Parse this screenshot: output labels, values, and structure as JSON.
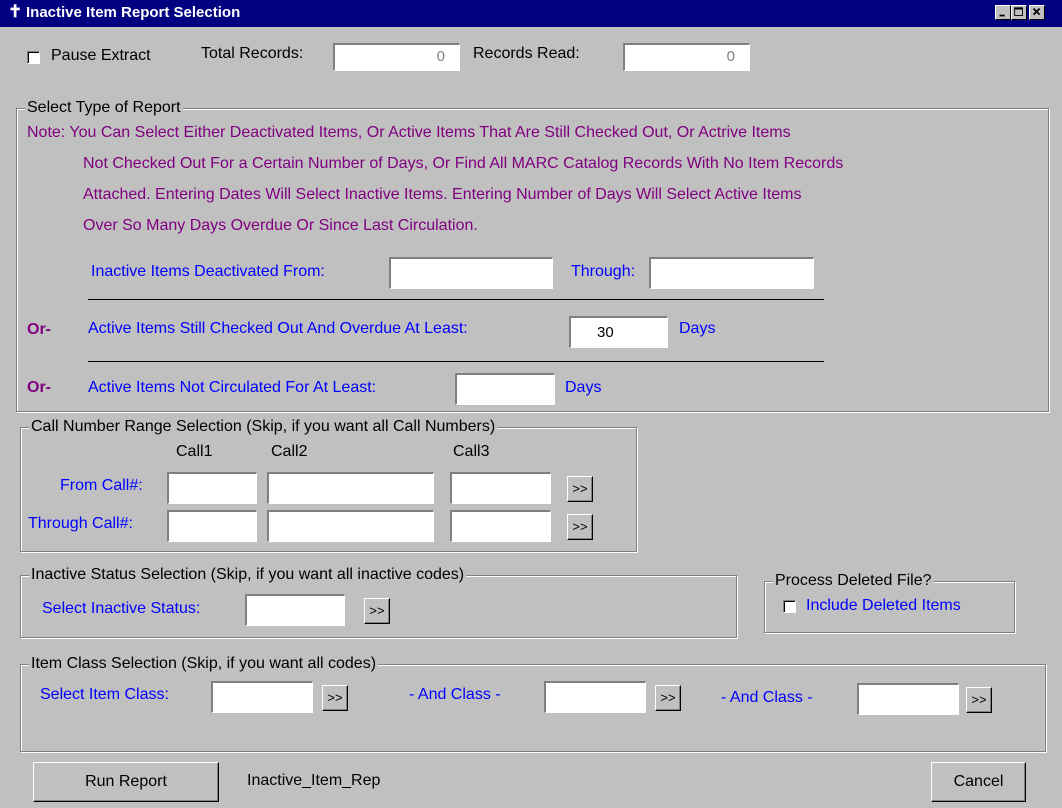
{
  "window": {
    "title": "Inactive Item Report Selection",
    "icon": "app-icon",
    "controls": [
      "minimize-icon",
      "maximize-icon",
      "close-icon"
    ]
  },
  "top": {
    "pause_label": "Pause Extract",
    "total_label": "Total Records:",
    "total_value": "0",
    "read_label": "Records Read:",
    "read_value": "0"
  },
  "report_type": {
    "legend": "Select Type of Report",
    "note_line1": "Note: You Can Select Either Deactivated Items, Or Active Items That Are Still Checked Out, Or Actrive Items",
    "note_line2": "Not Checked Out For a Certain Number of Days, Or Find All MARC Catalog Records With No Item Records",
    "note_line3": "Attached.  Entering Dates Will Select Inactive Items.  Entering Number of Days Will Select Active Items",
    "note_line4": "Over So Many Days Overdue Or Since Last Circulation.",
    "deactivated_label": "Inactive Items Deactivated From:",
    "deactivated_from": "",
    "through_label": "Through:",
    "deactivated_through": "",
    "or1": "Or-",
    "overdue_label": "Active Items Still Checked Out And Overdue At Least:",
    "overdue_days": "30",
    "days1": "Days",
    "or2": "Or-",
    "not_circ_label": "Active Items Not Circulated For At Least:",
    "not_circ_days": "",
    "days2": "Days"
  },
  "call_range": {
    "legend": "Call Number Range Selection (Skip, if you want all Call Numbers)",
    "col1": "Call1",
    "col2": "Call2",
    "col3": "Call3",
    "from_label": "From Call#:",
    "through_label": "Through Call#:",
    "lookup": ">>"
  },
  "inactive_status": {
    "legend": "Inactive Status Selection (Skip, if you want all inactive codes)",
    "label": "Select Inactive Status:",
    "value": "",
    "lookup": ">>"
  },
  "deleted": {
    "legend": "Process Deleted File?",
    "label": "Include Deleted Items"
  },
  "item_class": {
    "legend": "Item Class Selection (Skip, if you want all codes)",
    "label": "Select Item Class:",
    "and1": "- And Class -",
    "and2": "- And Class -",
    "lookup": ">>"
  },
  "footer": {
    "run_label": "Run Report",
    "report_name": "Inactive_Item_Rep",
    "cancel_label": "Cancel"
  }
}
